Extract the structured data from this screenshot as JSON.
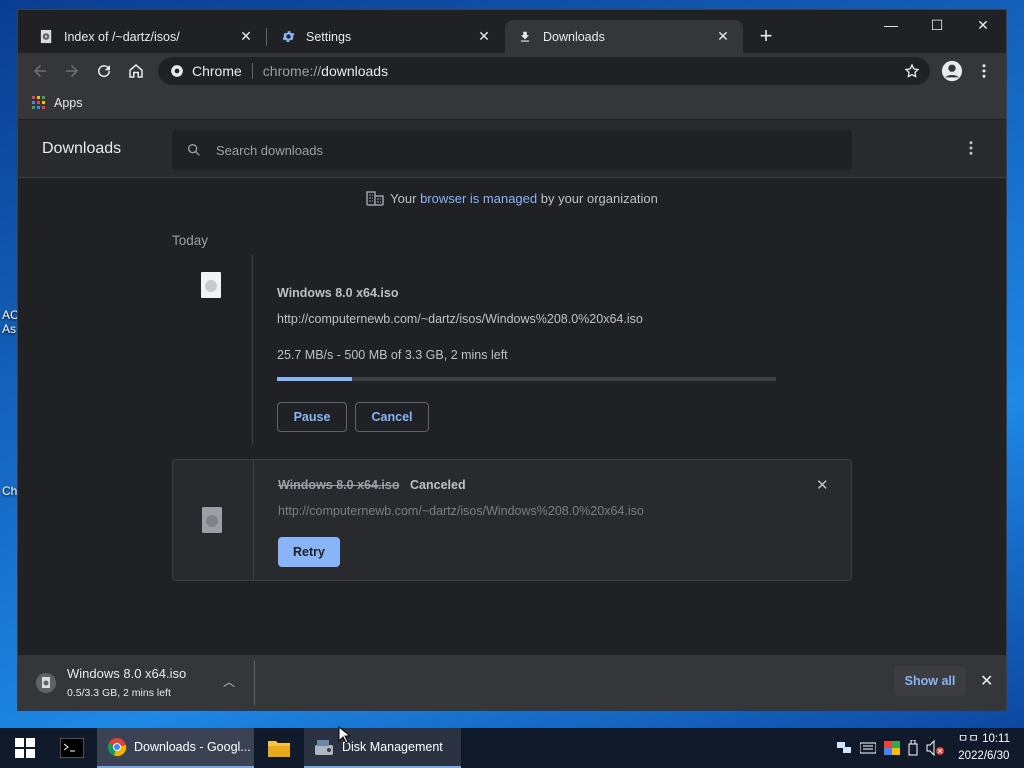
{
  "desktop": {
    "labels": [
      "AC",
      "As",
      "Ch"
    ]
  },
  "browser": {
    "tabs": [
      {
        "title": "Index of /~dartz/isos/",
        "icon": "page-icon",
        "active": false
      },
      {
        "title": "Settings",
        "icon": "gear-icon",
        "active": false
      },
      {
        "title": "Downloads",
        "icon": "download-icon",
        "active": true
      }
    ],
    "omnibox": {
      "chip": "Chrome",
      "url_prefix": "chrome://",
      "url_host": "downloads"
    },
    "bookmarks": {
      "apps_label": "Apps"
    }
  },
  "downloads_page": {
    "title": "Downloads",
    "search_placeholder": "Search downloads",
    "managed": {
      "pre": "Your ",
      "link": "browser is managed",
      "post": " by your organization"
    },
    "section_label": "Today",
    "items": [
      {
        "filename": "Windows 8.0 x64.iso",
        "url": "http://computernewb.com/~dartz/isos/Windows%208.0%20x64.iso",
        "progress_text": "25.7 MB/s - 500 MB of 3.3 GB, 2 mins left",
        "progress_fraction": 0.15,
        "pause_label": "Pause",
        "cancel_label": "Cancel"
      },
      {
        "filename": "Windows 8.0 x64.iso",
        "status": "Canceled",
        "url": "http://computernewb.com/~dartz/isos/Windows%208.0%20x64.iso",
        "retry_label": "Retry"
      }
    ]
  },
  "shelf": {
    "filename": "Windows 8.0 x64.iso",
    "sub": "0.5/3.3 GB, 2 mins left",
    "show_all_label": "Show all"
  },
  "taskbar": {
    "apps": [
      {
        "label": "Downloads - Googl...",
        "icon": "chrome-icon"
      },
      {
        "label": "Disk Management",
        "icon": "disk-management-icon"
      }
    ],
    "time": "10:11",
    "time_prefix": "ㅁㅁ",
    "date": "2022/6/30"
  },
  "colors": {
    "accent": "#8ab4f8",
    "surface": "#202124",
    "toolbar": "#35363a"
  }
}
